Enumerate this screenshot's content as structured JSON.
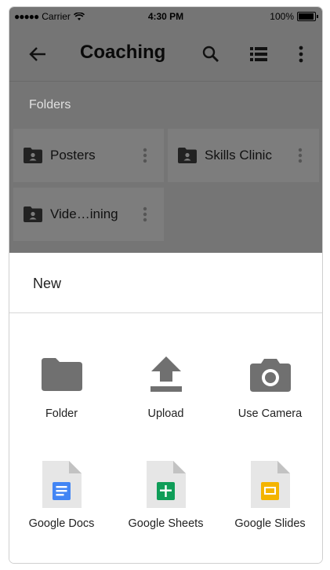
{
  "status_bar": {
    "signal": "●●●●●",
    "carrier": "Carrier",
    "time": "4:30 PM",
    "battery": "100%"
  },
  "toolbar": {
    "title": "Coaching",
    "icons": [
      "back-arrow-icon",
      "search-icon",
      "list-view-icon",
      "more-vert-icon"
    ]
  },
  "folders_section": {
    "label": "Folders",
    "items": [
      {
        "name": "Posters"
      },
      {
        "name": "Skills Clinic"
      },
      {
        "name": "Vide…ining"
      }
    ]
  },
  "new_sheet": {
    "title": "New",
    "actions": [
      {
        "label": "Folder",
        "icon": "folder-icon"
      },
      {
        "label": "Upload",
        "icon": "upload-icon"
      },
      {
        "label": "Use Camera",
        "icon": "camera-icon"
      },
      {
        "label": "Google Docs",
        "icon": "google-docs-icon",
        "color": "#4285f4"
      },
      {
        "label": "Google Sheets",
        "icon": "google-sheets-icon",
        "color": "#0f9d58"
      },
      {
        "label": "Google Slides",
        "icon": "google-slides-icon",
        "color": "#f4b400"
      }
    ]
  },
  "colors": {
    "scrim": "#757575",
    "card": "#7d7d7d",
    "icon_gray": "#707070"
  }
}
